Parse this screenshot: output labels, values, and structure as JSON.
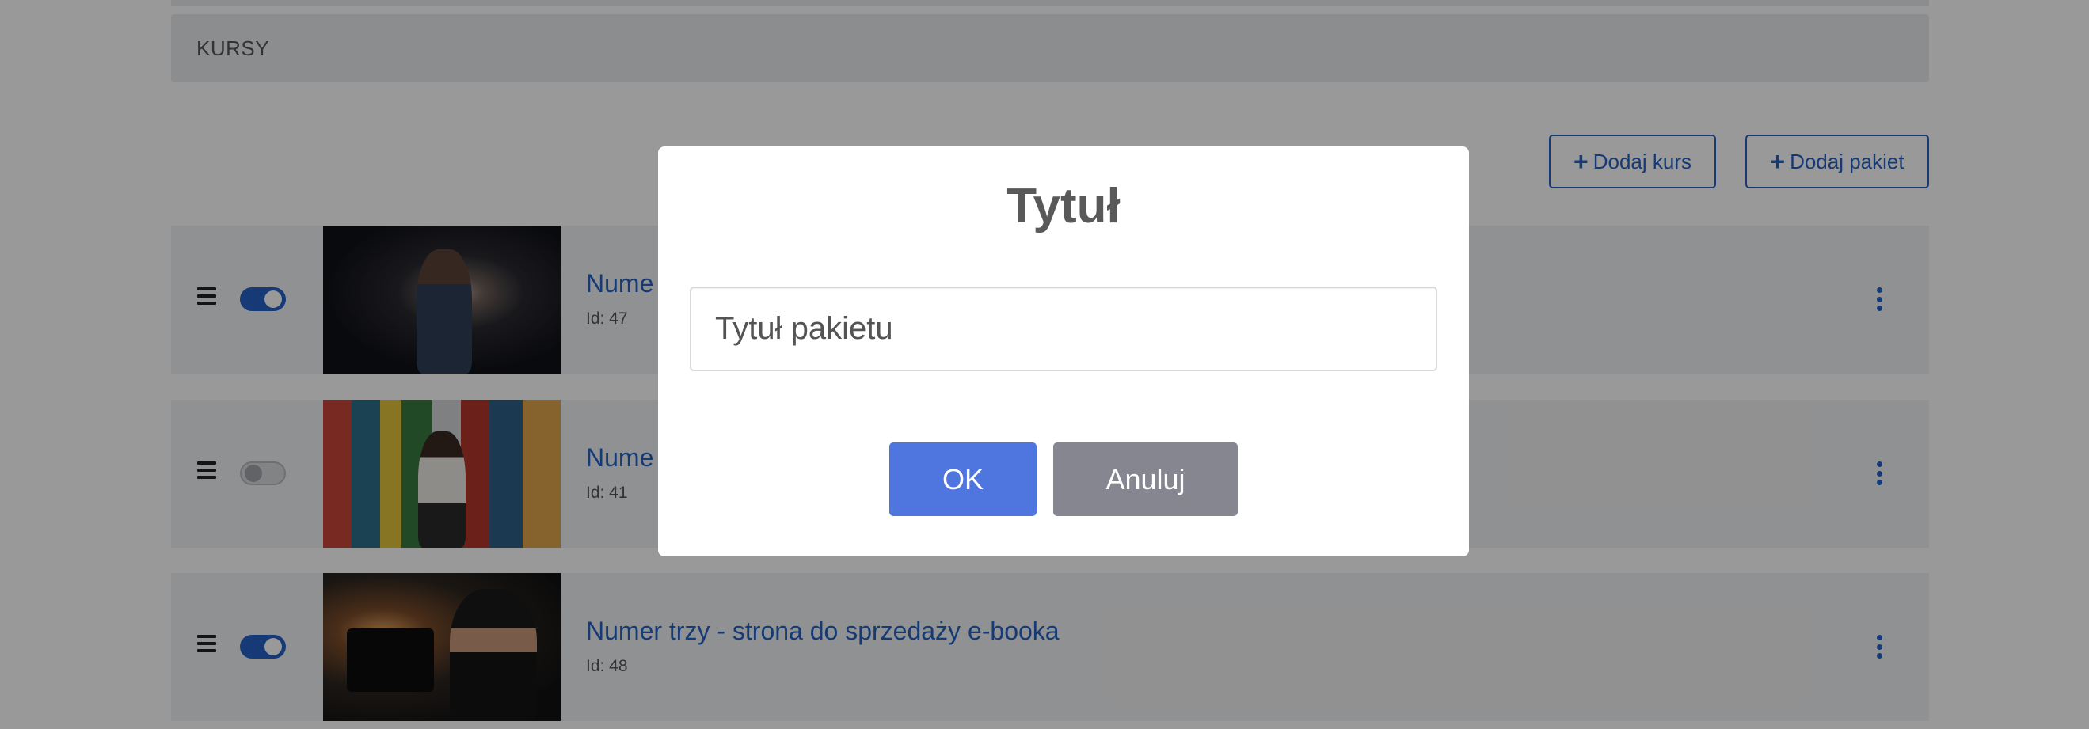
{
  "section": {
    "title": "KURSY"
  },
  "actions": {
    "add_course": "Dodaj kurs",
    "add_package": "Dodaj pakiet",
    "plus_glyph": "+"
  },
  "courses": [
    {
      "title": "Nume",
      "id_label": "Id: 47",
      "enabled": true
    },
    {
      "title": "Nume",
      "id_label": "Id: 41",
      "enabled": false
    },
    {
      "title": "Numer trzy - strona do sprzedaży e-booka",
      "id_label": "Id: 48",
      "enabled": true
    }
  ],
  "modal": {
    "title": "Tytuł",
    "input_placeholder": "Tytuł pakietu",
    "input_value": "",
    "ok_label": "OK",
    "cancel_label": "Anuluj"
  },
  "colors": {
    "accent": "#2361c4",
    "ok_button": "#4e76de",
    "cancel_button": "#868691",
    "overlay": "rgba(0,0,0,0.40)"
  },
  "icons": [
    "hamburger-icon",
    "plus-icon",
    "kebab-menu-icon"
  ]
}
